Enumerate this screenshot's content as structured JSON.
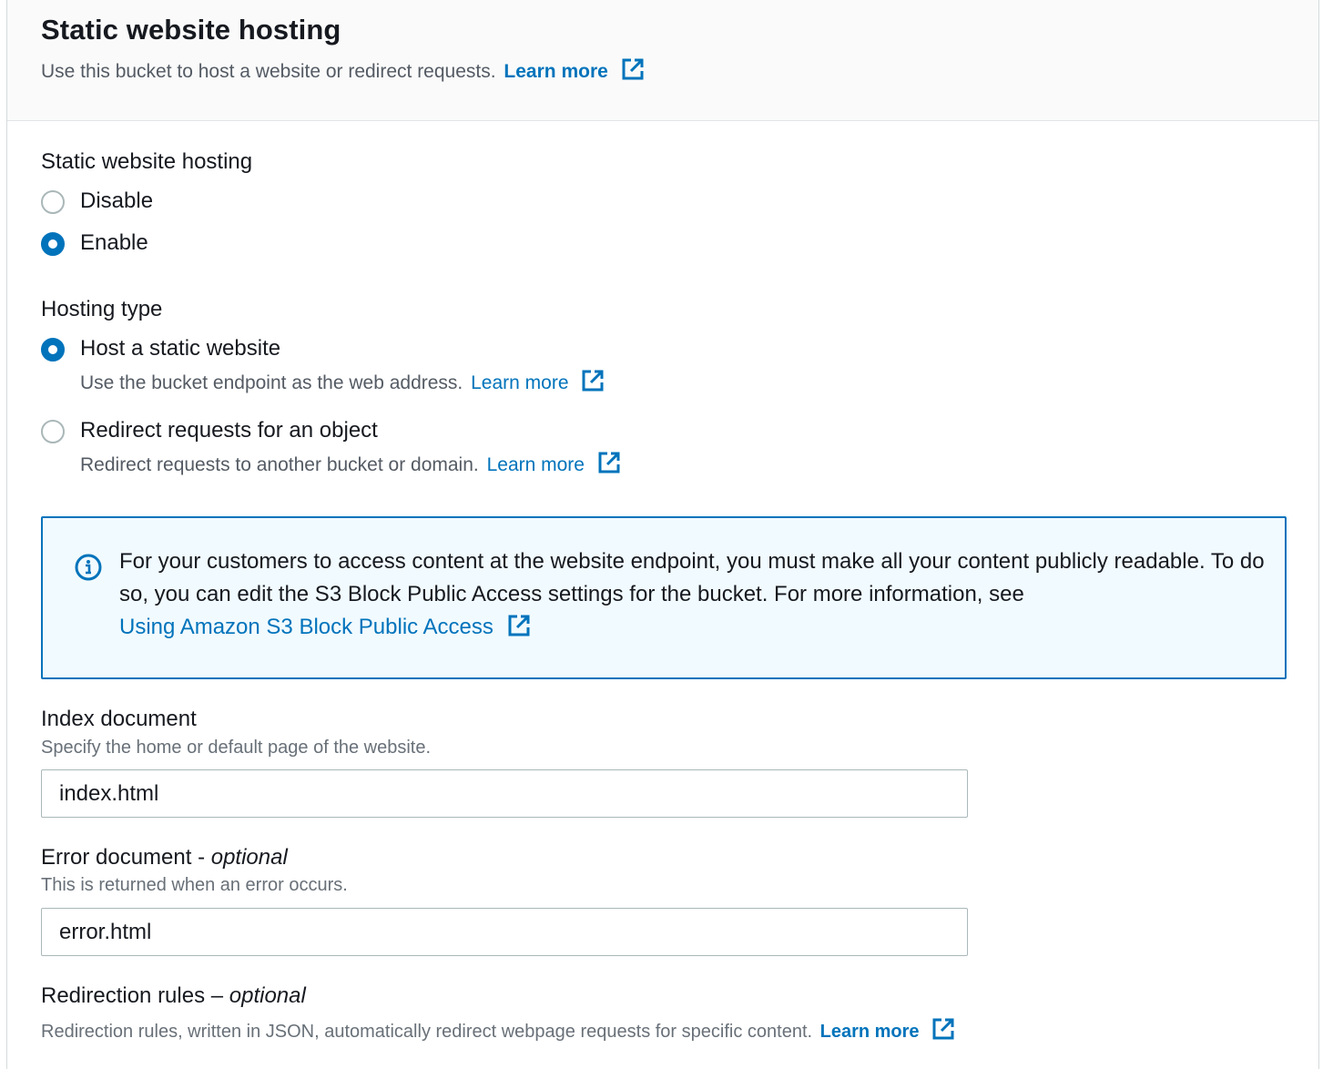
{
  "section": {
    "title": "Static website hosting",
    "description": "Use this bucket to host a website or redirect requests.",
    "learn_more": "Learn more"
  },
  "hosting_toggle": {
    "label": "Static website hosting",
    "options": [
      {
        "label": "Disable",
        "checked": false
      },
      {
        "label": "Enable",
        "checked": true
      }
    ]
  },
  "hosting_type": {
    "label": "Hosting type",
    "options": [
      {
        "label": "Host a static website",
        "description": "Use the bucket endpoint as the web address.",
        "learn_more": "Learn more",
        "checked": true
      },
      {
        "label": "Redirect requests for an object",
        "description": "Redirect requests to another bucket or domain.",
        "learn_more": "Learn more",
        "checked": false
      }
    ]
  },
  "info_alert": {
    "text": "For your customers to access content at the website endpoint, you must make all your content publicly readable. To do so, you can edit the S3 Block Public Access settings for the bucket. For more information, see",
    "link": "Using Amazon S3 Block Public Access"
  },
  "index_document": {
    "label": "Index document",
    "description": "Specify the home or default page of the website.",
    "value": "index.html"
  },
  "error_document": {
    "label": "Error document - ",
    "optional": "optional",
    "description": "This is returned when an error occurs.",
    "value": "error.html"
  },
  "redirection_rules": {
    "label": "Redirection rules – ",
    "optional": "optional",
    "description": "Redirection rules, written in JSON, automatically redirect webpage requests for specific content.",
    "learn_more": "Learn more"
  },
  "colors": {
    "link": "#0073bb",
    "info_bg": "#f1faff",
    "text": "#16191f",
    "muted": "#545b64"
  }
}
